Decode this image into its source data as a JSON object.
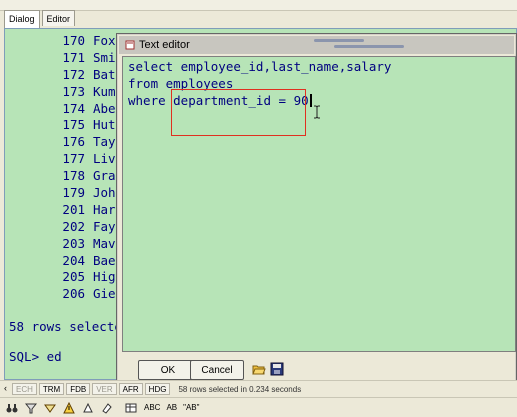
{
  "tabs": [
    {
      "label": "Dialog"
    },
    {
      "label": "Editor"
    }
  ],
  "results": {
    "rows": [
      {
        "id": "170",
        "name": "Fox"
      },
      {
        "id": "171",
        "name": "Smi"
      },
      {
        "id": "172",
        "name": "Bat"
      },
      {
        "id": "173",
        "name": "Kum"
      },
      {
        "id": "174",
        "name": "Abe"
      },
      {
        "id": "175",
        "name": "Hut"
      },
      {
        "id": "176",
        "name": "Tay"
      },
      {
        "id": "177",
        "name": "Liv"
      },
      {
        "id": "178",
        "name": "Gra"
      },
      {
        "id": "179",
        "name": "Joh"
      },
      {
        "id": "201",
        "name": "Har"
      },
      {
        "id": "202",
        "name": "Fay"
      },
      {
        "id": "203",
        "name": "Mav"
      },
      {
        "id": "204",
        "name": "Bae"
      },
      {
        "id": "205",
        "name": "Hig"
      },
      {
        "id": "206",
        "name": "Gie"
      }
    ],
    "rows_selected": "58 rows selecte",
    "prompt": "SQL> ed"
  },
  "editor": {
    "title": "Text editor",
    "lines": [
      "select employee_id,last_name,salary",
      "from employees",
      "where department_id = 90"
    ],
    "ok_label": "OK",
    "cancel_label": "Cancel"
  },
  "statusbar": {
    "segments": [
      "ECH",
      "TRM",
      "FDB",
      "VER",
      "AFR",
      "HDG"
    ],
    "message": "58 rows selected in 0.234 seconds"
  },
  "toolbar": {
    "abc_label": "ABC",
    "ab_label": "AB",
    "ab2_label": "\"AB\""
  },
  "colors": {
    "sql_background": "#b7e4b7",
    "sql_text": "#000080",
    "highlight": "#e03020"
  }
}
